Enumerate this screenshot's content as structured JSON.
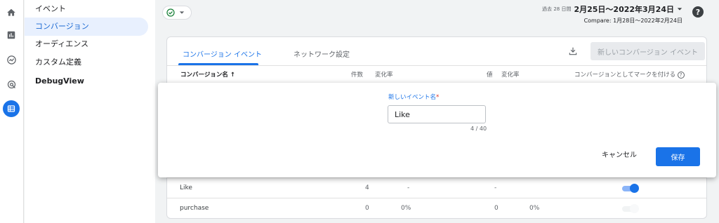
{
  "sidebar": {
    "items": [
      {
        "label": "イベント"
      },
      {
        "label": "コンバージョン"
      },
      {
        "label": "オーディエンス"
      },
      {
        "label": "カスタム定義"
      },
      {
        "label": "DebugView"
      }
    ]
  },
  "rail": {
    "icons": [
      "home-icon",
      "bar-chart-icon",
      "insights-icon",
      "explore-icon",
      "configure-icon"
    ],
    "active_color": "#1a73e8"
  },
  "header": {
    "date_prefix": "過去 28 日間",
    "date_range": "2月25日〜2022年3月24日",
    "compare": "Compare: 1月28日〜2022年2月24日",
    "help": "?"
  },
  "card": {
    "tabs": [
      {
        "label": "コンバージョン イベント"
      },
      {
        "label": "ネットワーク設定"
      }
    ],
    "new_event_button": "新しいコンバージョン イベント",
    "columns": {
      "name": "コンバージョン名",
      "count": "件数",
      "count_change": "変化率",
      "value": "値",
      "value_change": "変化率",
      "mark": "コンバージョンとしてマークを付ける"
    },
    "rows": [
      {
        "name": "Like",
        "count": "4",
        "count_change": "-",
        "value": "-",
        "value_change": "",
        "toggle_on": true
      },
      {
        "name": "purchase",
        "count": "0",
        "count_change": "0%",
        "value": "0",
        "value_change": "0%",
        "toggle_on": false
      }
    ]
  },
  "dialog": {
    "label": "新しいイベント名",
    "required_mark": "*",
    "input_value": "Like",
    "char_count": "4 / 40",
    "cancel_label": "キャンセル",
    "save_label": "保存"
  },
  "colors": {
    "accent": "#1a73e8",
    "status_green": "#188038"
  }
}
